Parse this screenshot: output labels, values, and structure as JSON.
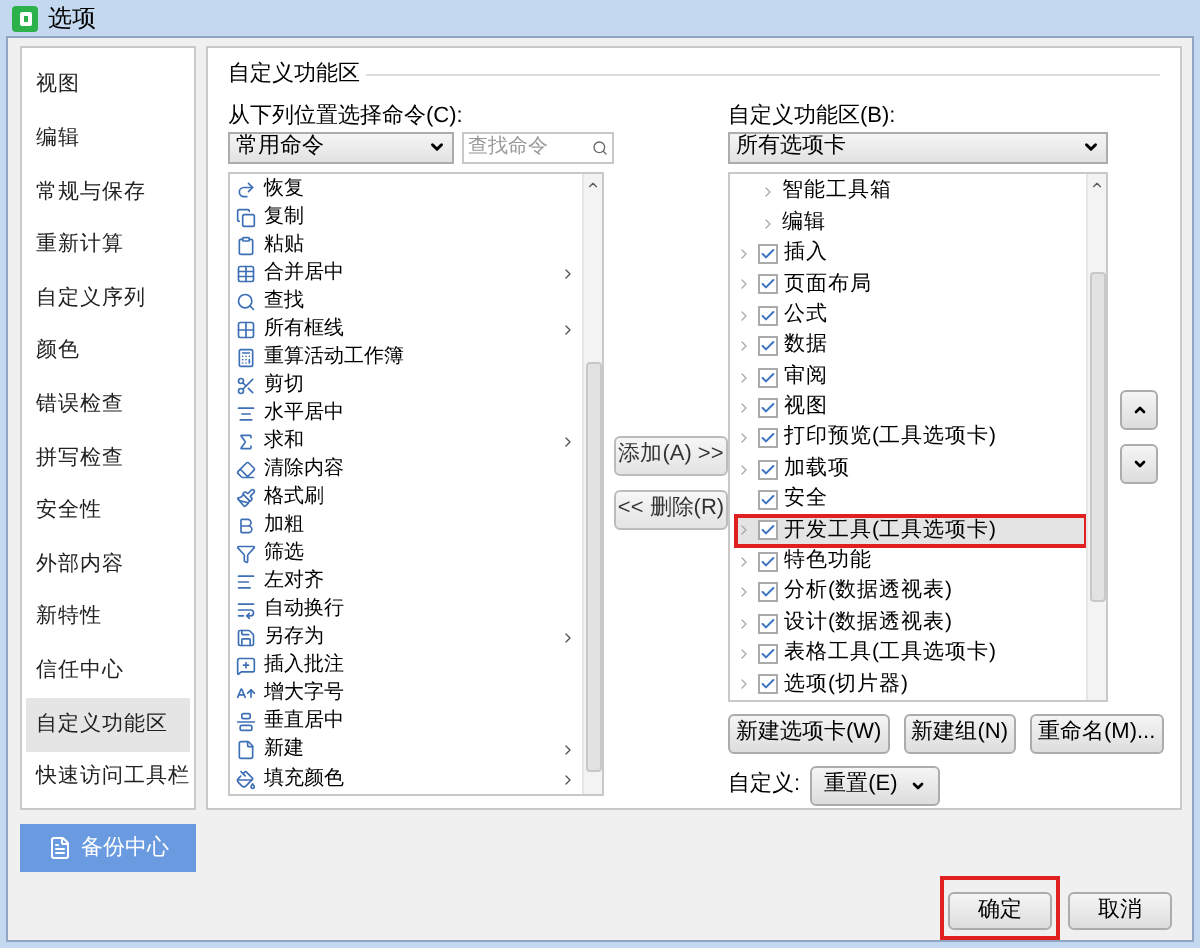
{
  "window": {
    "title": "选项"
  },
  "sidebar": {
    "items": [
      {
        "label": "视图",
        "selected": false
      },
      {
        "label": "编辑",
        "selected": false
      },
      {
        "label": "常规与保存",
        "selected": false
      },
      {
        "label": "重新计算",
        "selected": false
      },
      {
        "label": "自定义序列",
        "selected": false
      },
      {
        "label": "颜色",
        "selected": false
      },
      {
        "label": "错误检查",
        "selected": false
      },
      {
        "label": "拼写检查",
        "selected": false
      },
      {
        "label": "安全性",
        "selected": false
      },
      {
        "label": "外部内容",
        "selected": false
      },
      {
        "label": "新特性",
        "selected": false
      },
      {
        "label": "信任中心",
        "selected": false
      },
      {
        "label": "自定义功能区",
        "selected": true
      },
      {
        "label": "快速访问工具栏",
        "selected": false
      }
    ]
  },
  "backup_button": "备份中心",
  "section_title": "自定义功能区",
  "commands": {
    "label": "从下列位置选择命令(C):",
    "source": "常用命令",
    "search_placeholder": "查找命令",
    "items": [
      {
        "label": "恢复",
        "submenu": false
      },
      {
        "label": "复制",
        "submenu": false
      },
      {
        "label": "粘贴",
        "submenu": false
      },
      {
        "label": "合并居中",
        "submenu": true
      },
      {
        "label": "查找",
        "submenu": false
      },
      {
        "label": "所有框线",
        "submenu": true
      },
      {
        "label": "重算活动工作簿",
        "submenu": false
      },
      {
        "label": "剪切",
        "submenu": false
      },
      {
        "label": "水平居中",
        "submenu": false
      },
      {
        "label": "求和",
        "submenu": true
      },
      {
        "label": "清除内容",
        "submenu": false
      },
      {
        "label": "格式刷",
        "submenu": false
      },
      {
        "label": "加粗",
        "submenu": false
      },
      {
        "label": "筛选",
        "submenu": false
      },
      {
        "label": "左对齐",
        "submenu": false
      },
      {
        "label": "自动换行",
        "submenu": false
      },
      {
        "label": "另存为",
        "submenu": true
      },
      {
        "label": "插入批注",
        "submenu": false
      },
      {
        "label": "增大字号",
        "submenu": false
      },
      {
        "label": "垂直居中",
        "submenu": false
      },
      {
        "label": "新建",
        "submenu": true
      },
      {
        "label": "填充颜色",
        "submenu": true
      }
    ]
  },
  "add_button": {
    "label": "添加(A) >>",
    "disabled": true
  },
  "remove_button": {
    "label": "<< 删除(R)",
    "disabled": true
  },
  "ribbon": {
    "label": "自定义功能区(B):",
    "source": "所有选项卡",
    "items": [
      {
        "kind": "group",
        "label": "智能工具箱",
        "expandable": true,
        "selected": false,
        "highlighted": false
      },
      {
        "kind": "group",
        "label": "编辑",
        "expandable": true,
        "selected": false,
        "highlighted": false
      },
      {
        "kind": "tab",
        "label": "插入",
        "expandable": true,
        "checked": true,
        "selected": false,
        "highlighted": false
      },
      {
        "kind": "tab",
        "label": "页面布局",
        "expandable": true,
        "checked": true,
        "selected": false,
        "highlighted": false
      },
      {
        "kind": "tab",
        "label": "公式",
        "expandable": true,
        "checked": true,
        "selected": false,
        "highlighted": false
      },
      {
        "kind": "tab",
        "label": "数据",
        "expandable": true,
        "checked": true,
        "selected": false,
        "highlighted": false
      },
      {
        "kind": "tab",
        "label": "审阅",
        "expandable": true,
        "checked": true,
        "selected": false,
        "highlighted": false
      },
      {
        "kind": "tab",
        "label": "视图",
        "expandable": true,
        "checked": true,
        "selected": false,
        "highlighted": false
      },
      {
        "kind": "tab",
        "label": "打印预览(工具选项卡)",
        "expandable": true,
        "checked": true,
        "selected": false,
        "highlighted": false
      },
      {
        "kind": "tab",
        "label": "加载项",
        "expandable": true,
        "checked": true,
        "selected": false,
        "highlighted": false
      },
      {
        "kind": "tab",
        "label": "安全",
        "expandable": false,
        "checked": true,
        "selected": false,
        "highlighted": false
      },
      {
        "kind": "tab",
        "label": "开发工具(工具选项卡)",
        "expandable": true,
        "checked": true,
        "selected": true,
        "highlighted": true
      },
      {
        "kind": "tab",
        "label": "特色功能",
        "expandable": true,
        "checked": true,
        "selected": false,
        "highlighted": false
      },
      {
        "kind": "tab",
        "label": "分析(数据透视表)",
        "expandable": true,
        "checked": true,
        "selected": false,
        "highlighted": false
      },
      {
        "kind": "tab",
        "label": "设计(数据透视表)",
        "expandable": true,
        "checked": true,
        "selected": false,
        "highlighted": false
      },
      {
        "kind": "tab",
        "label": "表格工具(工具选项卡)",
        "expandable": true,
        "checked": true,
        "selected": false,
        "highlighted": false
      },
      {
        "kind": "tab",
        "label": "选项(切片器)",
        "expandable": true,
        "checked": true,
        "selected": false,
        "highlighted": false
      }
    ]
  },
  "ribbon_buttons": [
    "新建选项卡(W)",
    "新建组(N)",
    "重命名(M)..."
  ],
  "customize": {
    "label": "自定义:",
    "button": "重置(E)"
  },
  "footer": {
    "ok": {
      "label": "确定",
      "highlighted": true
    },
    "cancel": {
      "label": "取消",
      "highlighted": false
    }
  }
}
